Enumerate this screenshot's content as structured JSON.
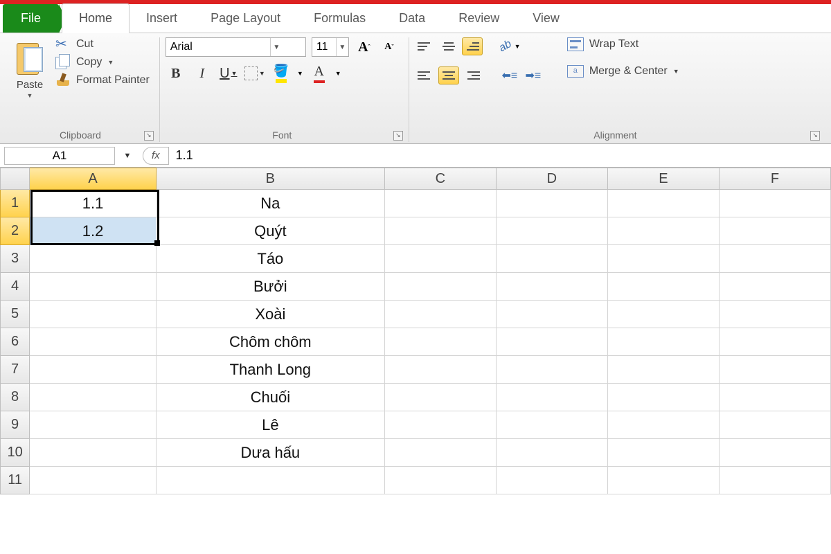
{
  "tabs": {
    "file": "File",
    "list": [
      "Home",
      "Insert",
      "Page Layout",
      "Formulas",
      "Data",
      "Review",
      "View"
    ],
    "active": "Home"
  },
  "ribbon": {
    "clipboard": {
      "title": "Clipboard",
      "paste": "Paste",
      "cut": "Cut",
      "copy": "Copy",
      "format_painter": "Format Painter"
    },
    "font": {
      "title": "Font",
      "name": "Arial",
      "size": "11",
      "grow": "A",
      "shrink": "A",
      "bold": "B",
      "italic": "I",
      "underline": "U",
      "bigA": "A"
    },
    "alignment": {
      "title": "Alignment",
      "wrap": "Wrap Text",
      "merge": "Merge & Center"
    }
  },
  "formula": {
    "cell_ref": "A1",
    "fx": "fx",
    "value": "1.1"
  },
  "columns": [
    "A",
    "B",
    "C",
    "D",
    "E",
    "F"
  ],
  "rows": [
    {
      "n": "1",
      "A": "1.1",
      "B": "Na"
    },
    {
      "n": "2",
      "A": "1.2",
      "B": "Quýt"
    },
    {
      "n": "3",
      "A": "",
      "B": "Táo"
    },
    {
      "n": "4",
      "A": "",
      "B": "Bưởi"
    },
    {
      "n": "5",
      "A": "",
      "B": "Xoài"
    },
    {
      "n": "6",
      "A": "",
      "B": "Chôm chôm"
    },
    {
      "n": "7",
      "A": "",
      "B": "Thanh Long"
    },
    {
      "n": "8",
      "A": "",
      "B": "Chuối"
    },
    {
      "n": "9",
      "A": "",
      "B": "Lê"
    },
    {
      "n": "10",
      "A": "",
      "B": "Dưa hấu"
    },
    {
      "n": "11",
      "A": "",
      "B": ""
    }
  ],
  "selection": {
    "start": "A1",
    "end": "A2"
  }
}
